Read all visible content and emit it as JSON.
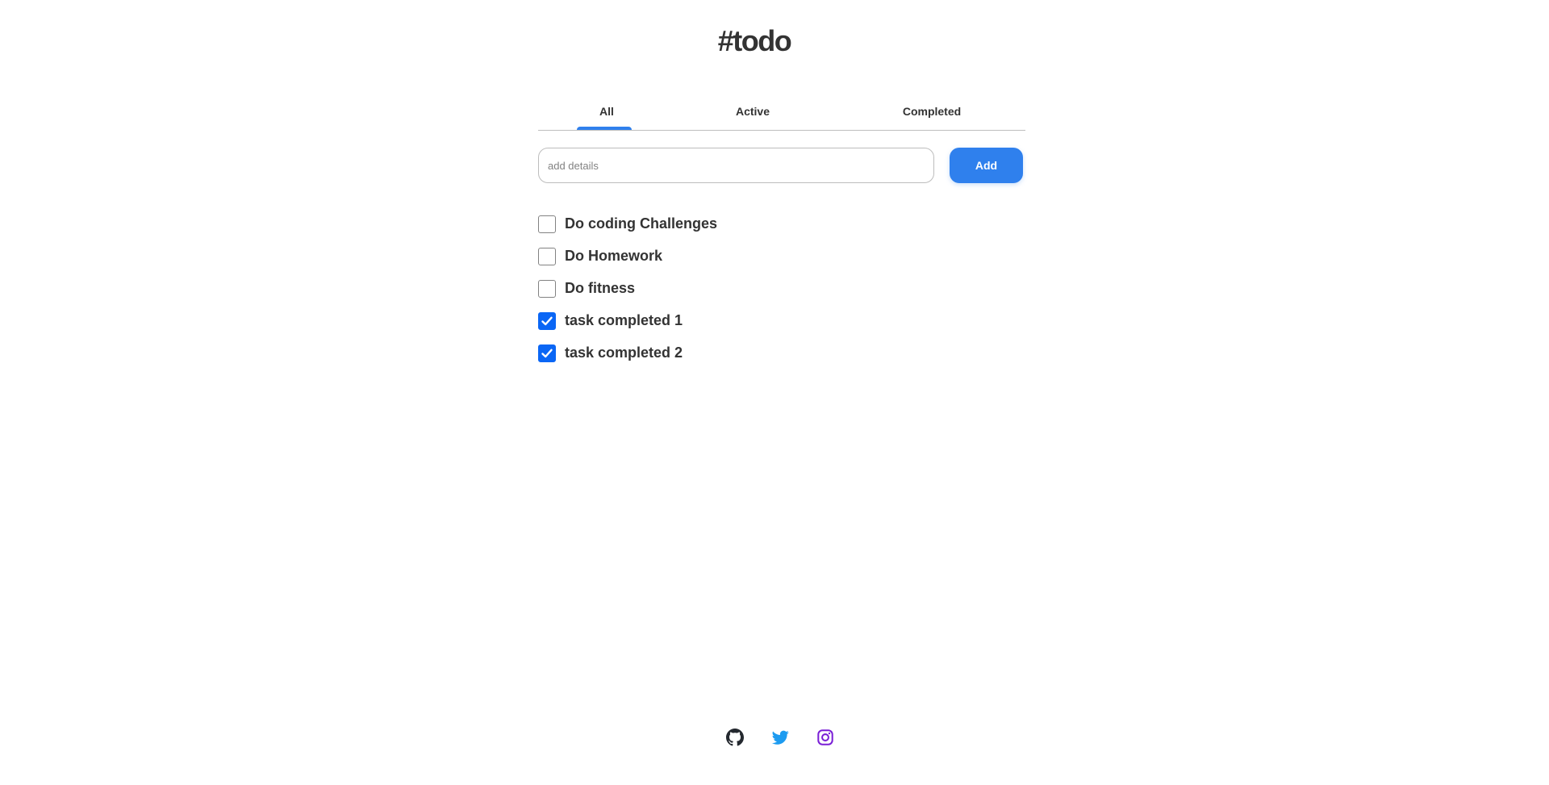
{
  "app": {
    "title": "#todo"
  },
  "tabs": [
    {
      "label": "All",
      "selected": true
    },
    {
      "label": "Active",
      "selected": false
    },
    {
      "label": "Completed",
      "selected": false
    }
  ],
  "add_form": {
    "placeholder": "add details",
    "value": "",
    "button_label": "Add"
  },
  "tasks": [
    {
      "label": "Do coding Challenges",
      "completed": false
    },
    {
      "label": "Do Homework",
      "completed": false
    },
    {
      "label": "Do fitness",
      "completed": false
    },
    {
      "label": "task completed 1",
      "completed": true
    },
    {
      "label": "task completed 2",
      "completed": true
    }
  ],
  "footer": {
    "icons": [
      "github-icon",
      "twitter-icon",
      "instagram-icon"
    ]
  },
  "colors": {
    "accent": "#2f80ed",
    "checkbox_checked": "#0a66f5",
    "text": "#333333",
    "twitter": "#1d9bf0",
    "instagram": "#7a1fd6"
  }
}
